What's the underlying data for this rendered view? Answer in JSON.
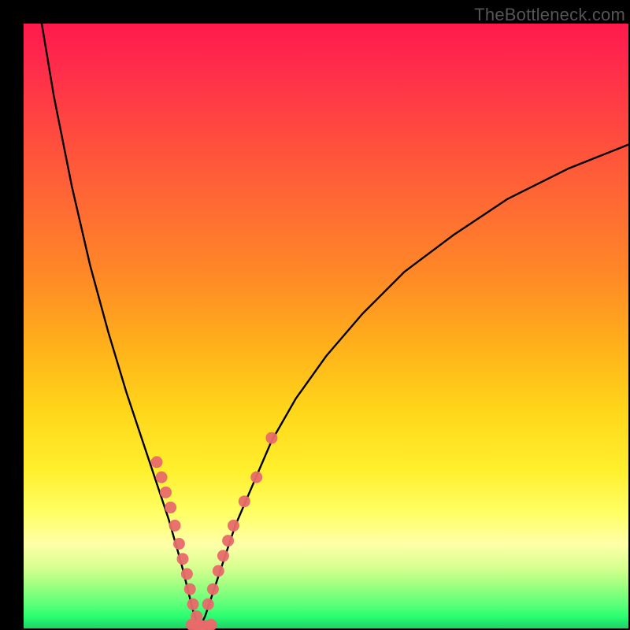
{
  "watermark": "TheBottleneck.com",
  "colors": {
    "curve": "#000000",
    "marker": "#e86a6a",
    "bg_top": "#ff1a4d",
    "bg_bottom": "#1fd166"
  },
  "chart_data": {
    "type": "line",
    "title": "",
    "xlabel": "",
    "ylabel": "",
    "xlim": [
      0,
      100
    ],
    "ylim": [
      0,
      100
    ],
    "grid": false,
    "legend": null,
    "series": [
      {
        "name": "bottleneck-curve",
        "comment": "V-shaped curve; y is bottleneck percentage (0 at optimum ~x=29). Values estimated from pixel positions.",
        "x": [
          3,
          5,
          8,
          11,
          14,
          17,
          20,
          22,
          24,
          26,
          27,
          28,
          29,
          30,
          31,
          33,
          35,
          38,
          41,
          45,
          50,
          56,
          63,
          71,
          80,
          90,
          100
        ],
        "y": [
          100,
          88,
          73,
          60,
          49,
          39,
          30,
          24,
          18,
          11,
          7,
          3,
          0,
          2,
          5,
          11,
          17,
          24,
          31,
          38,
          45,
          52,
          59,
          65,
          71,
          76,
          80
        ]
      },
      {
        "name": "left-branch-markers",
        "comment": "salmon dots clustered on lower-left limb",
        "x": [
          22.0,
          22.8,
          23.5,
          24.3,
          25.0,
          25.7,
          26.3,
          27.0,
          27.5,
          28.0,
          28.6,
          29.2
        ],
        "y": [
          27.5,
          25.0,
          22.5,
          20.0,
          17.0,
          14.0,
          11.5,
          9.0,
          6.5,
          4.0,
          2.0,
          0.5
        ]
      },
      {
        "name": "right-branch-markers",
        "comment": "salmon dots on lower-right limb",
        "x": [
          30.5,
          31.3,
          32.2,
          33.0,
          33.8,
          34.7,
          36.5,
          38.5,
          41.0
        ],
        "y": [
          4.0,
          6.5,
          9.5,
          12.0,
          14.5,
          17.0,
          21.0,
          25.0,
          31.5
        ]
      },
      {
        "name": "bottom-markers",
        "comment": "flat cluster at the valley bottom",
        "x": [
          27.8,
          28.6,
          29.4,
          30.2,
          31.0
        ],
        "y": [
          0.6,
          0.4,
          0.3,
          0.4,
          0.6
        ]
      }
    ]
  }
}
